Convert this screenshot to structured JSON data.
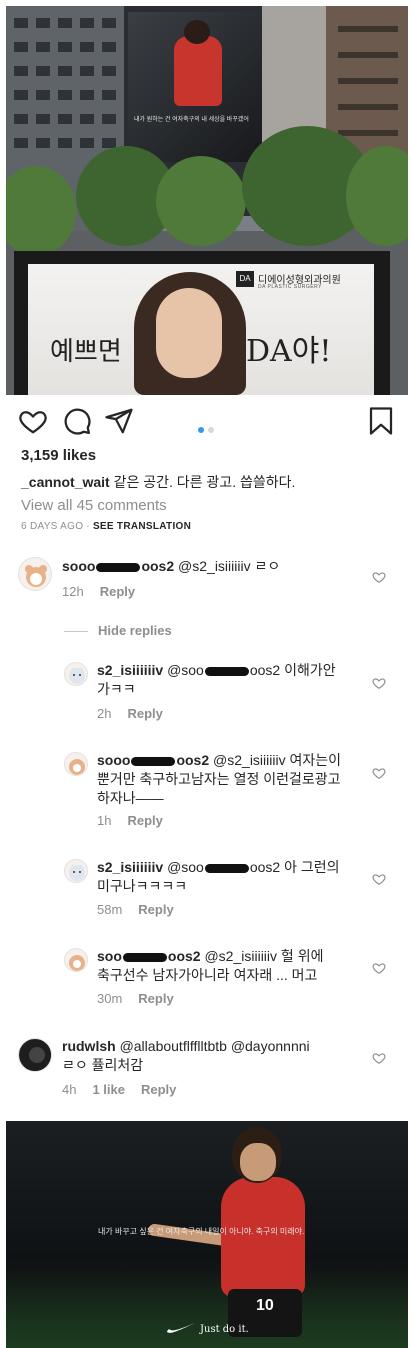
{
  "post": {
    "likes": "3,159 likes",
    "caption_user": "_cannot_wait",
    "caption_text": "같은 공간. 다른 광고. 씁쓸하다.",
    "view_all": "View all 45 comments",
    "age": "6 DAYS AGO",
    "separator": "·",
    "translate": "SEE TRANSLATION"
  },
  "photo_top": {
    "billboard_text": "내가 원하는 건 여자축구의 내 세상을 바꾸겠어",
    "clinic_name": "디에이성형외과의원",
    "clinic_logo": "DA",
    "clinic_sub": "DA PLASTIC SURGERY",
    "ad_left": "예쁘면",
    "ad_right": "DA야!"
  },
  "carousel": {
    "total": 2,
    "active": 1
  },
  "comments_ui": {
    "reply_label": "Reply",
    "hide_replies": "Hide replies"
  },
  "comments": [
    {
      "user_a": "sooo",
      "user_b": "oos2",
      "mention": "@s2_isiiiiiiv",
      "text": " ㄹㅇ",
      "time": "12h"
    },
    {
      "user": "s2_isiiiiiiv",
      "mention_a": "@soo",
      "mention_b": "oos2",
      "text_1": " 이해가안",
      "text_2": "가ㅋㅋ",
      "time": "2h"
    },
    {
      "user_a": "sooo",
      "user_b": "oos2",
      "mention": "@s2_isiiiiiiv",
      "text_1": " 여자는이",
      "text_2": "뿐거만 축구하고남자는 열정 이런걸로광고",
      "text_3": "하자나——",
      "time": "1h"
    },
    {
      "user": "s2_isiiiiiiv",
      "mention_a": "@soo",
      "mention_b": "oos2",
      "text_1": " 아 그런의",
      "text_2": "미구나ㅋㅋㅋㅋ",
      "time": "58m"
    },
    {
      "user_a": "soo",
      "user_b": "oos2",
      "mention": "@s2_isiiiiiiv",
      "text_1": " 헐 위에",
      "text_2": "축구선수 남자가아니라 여자래 ... 머고",
      "time": "30m"
    },
    {
      "user": "rudwlsh",
      "mention_1": "@allaboutflfflltbtb",
      "mention_2": "@dayonnnni",
      "text_2": "ㄹㅇ 퓰리처감",
      "time": "4h",
      "likes": "1 like"
    }
  ],
  "photo_bottom": {
    "slogan": "내가 바꾸고 싶은 건 여자축구의 내일이 아니야. 축구의 미래야.",
    "jersey_number": "10",
    "brand": "Just do it."
  },
  "colors": {
    "text": "#262626",
    "secondary": "#8e8e8e",
    "dot_active": "#3897f0",
    "dot_inactive": "#d8d8d8",
    "jersey": "#c8302b"
  },
  "icons": [
    "heart-icon",
    "comment-icon",
    "share-icon",
    "bookmark-icon",
    "small-heart-icon",
    "nike-swoosh-icon"
  ]
}
